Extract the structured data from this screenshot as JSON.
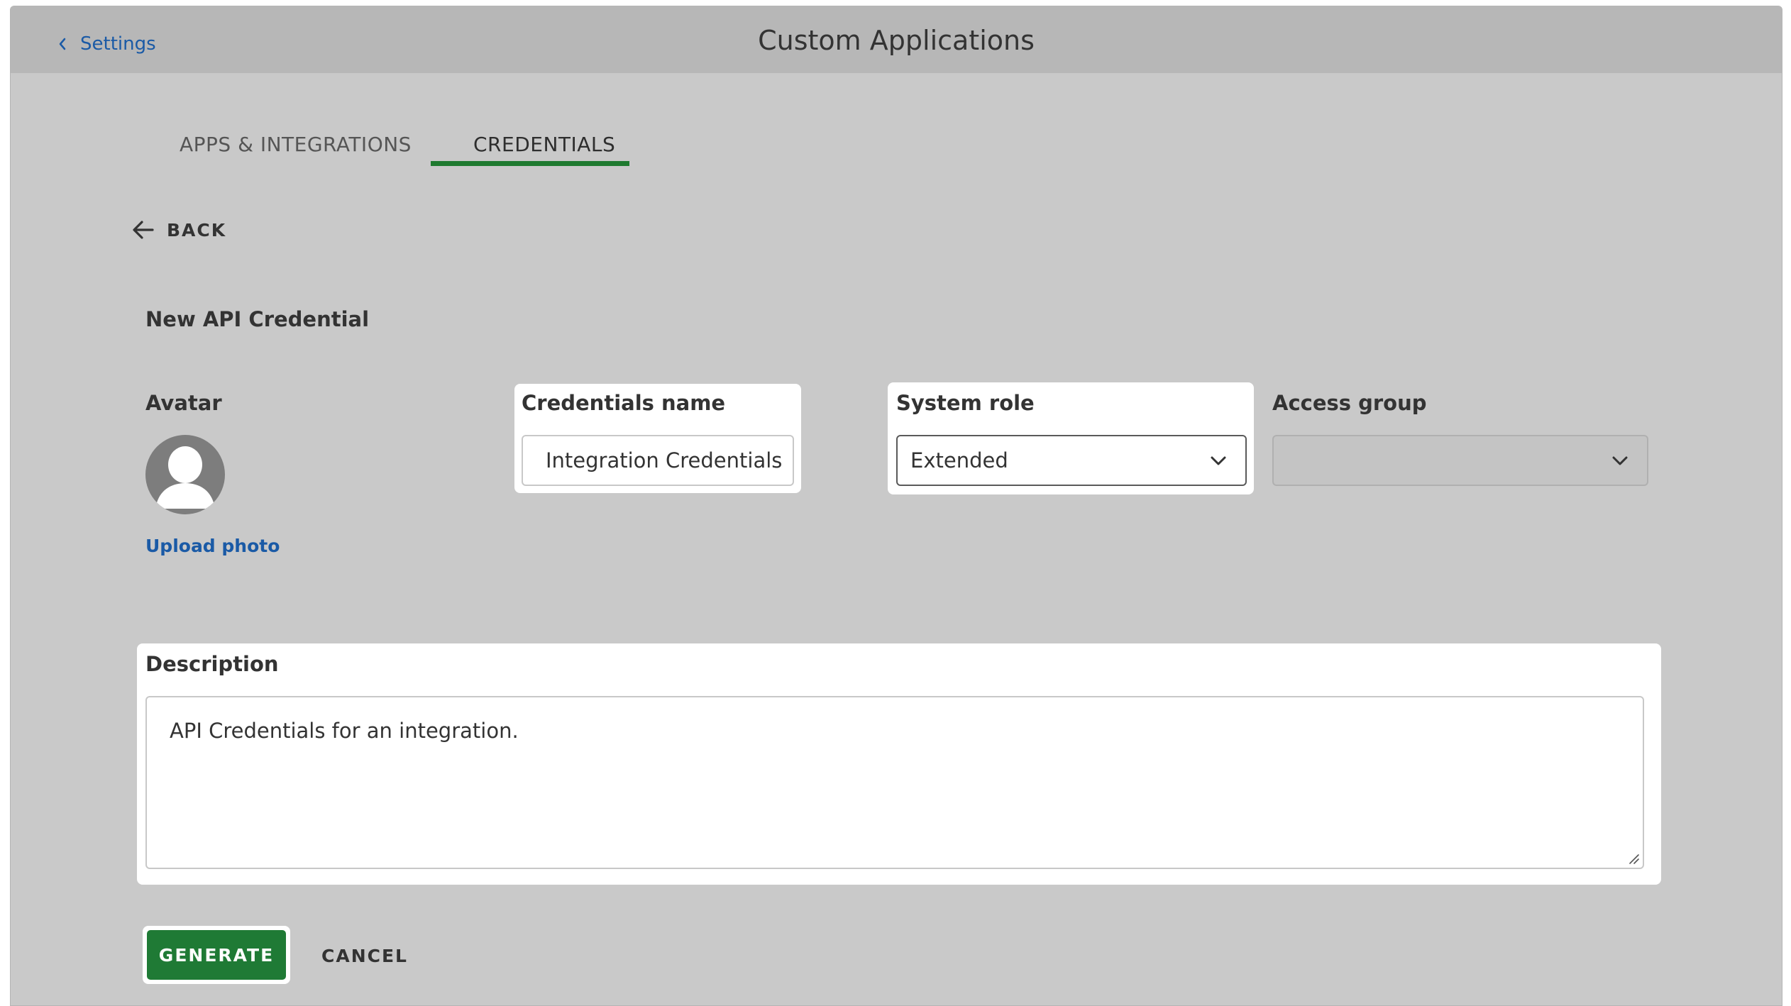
{
  "window": {
    "title": "Custom Applications"
  },
  "nav": {
    "back_label": "Settings",
    "back_icon": "chevron-left-icon"
  },
  "tabs": [
    {
      "label": "APPS & INTEGRATIONS",
      "active": false
    },
    {
      "label": "CREDENTIALS",
      "active": true
    }
  ],
  "back_button": {
    "label": "BACK",
    "icon": "arrow-left-icon"
  },
  "form": {
    "title": "New API Credential",
    "avatar": {
      "label": "Avatar",
      "upload_label": "Upload photo"
    },
    "credentials_name": {
      "label": "Credentials name",
      "value": "Integration Credentials"
    },
    "system_role": {
      "label": "System role",
      "value": "Extended"
    },
    "access_group": {
      "label": "Access group",
      "value": ""
    },
    "description": {
      "label": "Description",
      "value": "API Credentials for an integration."
    }
  },
  "actions": {
    "generate_label": "GENERATE",
    "cancel_label": "CANCEL"
  },
  "colors": {
    "accent_green": "#1f7a35",
    "link_blue": "#1a5aa6",
    "background": "#c9c9c9",
    "header": "#b7b7b7"
  }
}
